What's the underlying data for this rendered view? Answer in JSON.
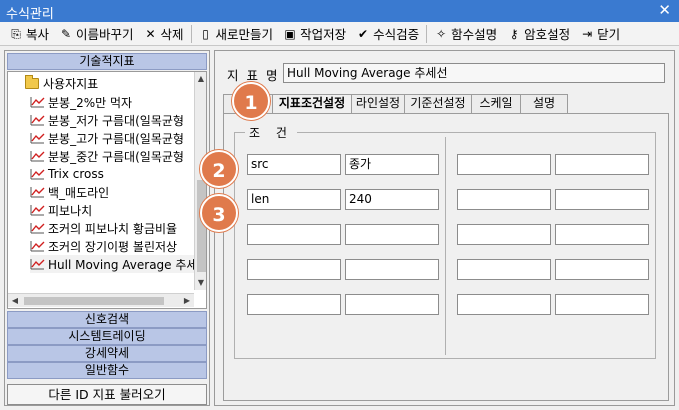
{
  "window": {
    "title": "수식관리",
    "close_glyph": "✕"
  },
  "toolbar": {
    "items": [
      {
        "label": "복사",
        "icon": "copy-icon",
        "glyph": "⎘"
      },
      {
        "label": "이름바꾸기",
        "icon": "rename-icon",
        "glyph": "✎"
      },
      {
        "label": "삭제",
        "icon": "delete-icon",
        "glyph": "✕"
      },
      {
        "label": "새로만들기",
        "icon": "new-file-icon",
        "glyph": "▯"
      },
      {
        "label": "작업저장",
        "icon": "save-icon",
        "glyph": "▣"
      },
      {
        "label": "수식검증",
        "icon": "check-icon",
        "glyph": "✔"
      },
      {
        "label": "함수설명",
        "icon": "magic-wand-icon",
        "glyph": "✧"
      },
      {
        "label": "암호설정",
        "icon": "key-icon",
        "glyph": "⚷"
      },
      {
        "label": "닫기",
        "icon": "exit-icon",
        "glyph": "⇥"
      }
    ]
  },
  "left": {
    "header_top": "기술적지표",
    "tree_root": "사용자지표",
    "tree_items": [
      "분봉_2%만 먹자",
      "분봉_저가 구름대(일목균형",
      "분봉_고가 구름대(일목균형",
      "분봉_중간 구름대(일목균형",
      "Trix cross",
      "백_매도라인",
      "피보나치",
      "조커의 피보나치 황금비율",
      "조커의 장기이평 볼린저상",
      "Hull Moving Average 추세"
    ],
    "sections": [
      "신호검색",
      "시스템트레이딩",
      "강세약세",
      "일반함수"
    ],
    "load_button": "다른 ID 지표 불러오기"
  },
  "right": {
    "name_label": "지 표 명",
    "name_value": "Hull Moving Average 추세선",
    "tabs": [
      "지표조건설정",
      "라인설정",
      "기준선설정",
      "스케일",
      "설명"
    ],
    "active_tab": 0,
    "group_title": "조 건",
    "conditions": [
      {
        "name": "src",
        "value": "종가"
      },
      {
        "name": "len",
        "value": "240"
      }
    ]
  },
  "badges": [
    "1",
    "2",
    "3"
  ],
  "colors": {
    "titlebar": "#3a7ad0",
    "section_header": "#b9c6e6",
    "badge": "#e07a4c"
  }
}
